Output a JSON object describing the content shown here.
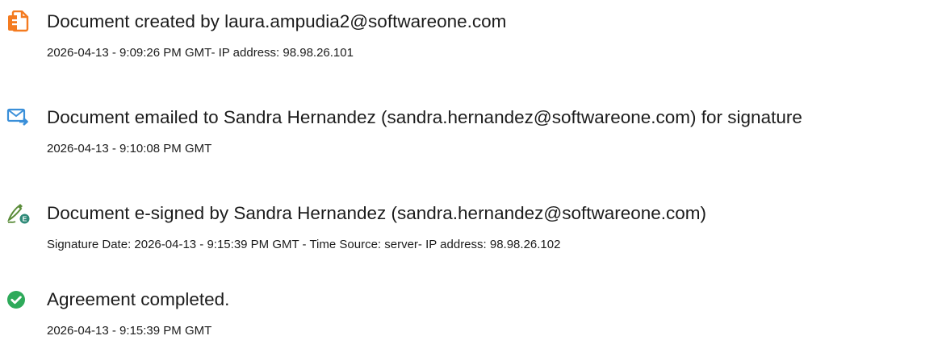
{
  "events": [
    {
      "icon": "document-created-icon",
      "title": "Document created by laura.ampudia2@softwareone.com",
      "meta": "2026-04-13 - 9:09:26 PM GMT- IP address: 98.98.26.101"
    },
    {
      "icon": "email-sent-icon",
      "title": "Document emailed to Sandra Hernandez (sandra.hernandez@softwareone.com) for signature",
      "meta": "2026-04-13 - 9:10:08 PM GMT"
    },
    {
      "icon": "e-signature-icon",
      "title": "Document e-signed by Sandra Hernandez (sandra.hernandez@softwareone.com)",
      "meta": "Signature Date: 2026-04-13 - 9:15:39 PM GMT - Time Source: server- IP address: 98.98.26.102"
    },
    {
      "icon": "check-circle-icon",
      "title": "Agreement completed.",
      "meta": "2026-04-13 - 9:15:39 PM GMT"
    }
  ],
  "colors": {
    "created_icon": "#f47b20",
    "email_icon": "#3a8fd9",
    "sign_icon": "#5b8c3a",
    "complete_icon": "#2eaa5a"
  }
}
